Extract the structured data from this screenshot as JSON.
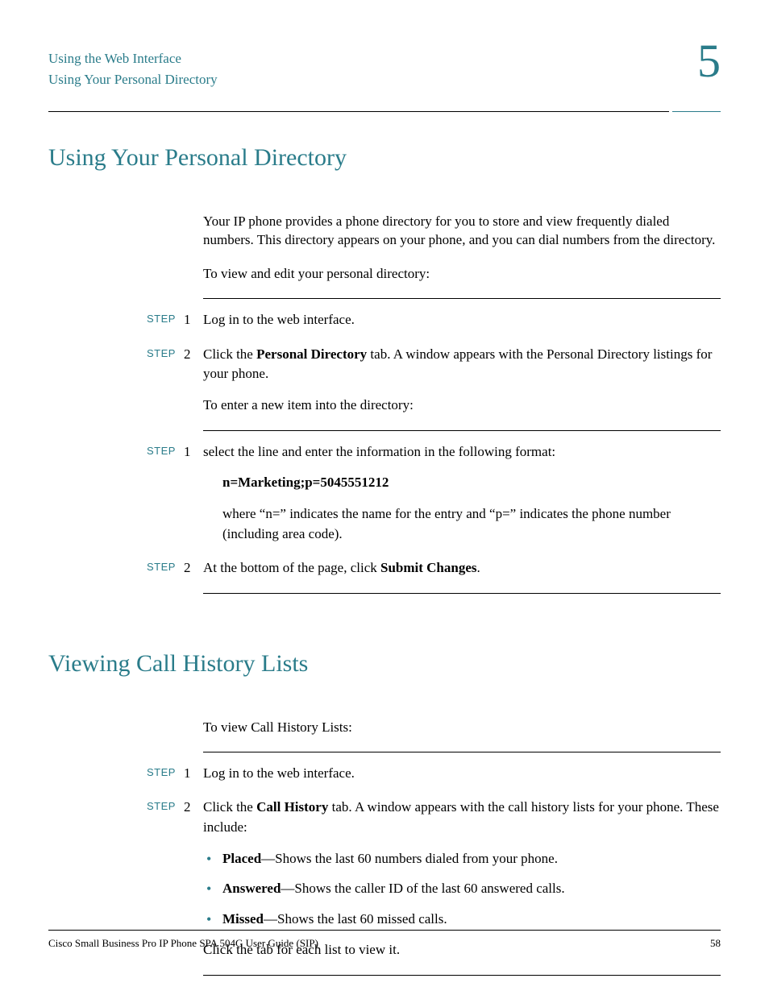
{
  "header": {
    "line1": "Using the Web Interface",
    "line2": "Using Your Personal Directory",
    "chapter_number": "5"
  },
  "section1": {
    "title": "Using Your Personal Directory",
    "intro1": "Your IP phone provides a phone directory for you to store and view frequently dialed numbers. This directory appears on your phone, and you can dial numbers from the directory.",
    "intro2": "To view and edit your personal directory:",
    "steps_a": [
      {
        "label": "STEP",
        "num": "1",
        "text_plain": "Log in to the web interface."
      },
      {
        "label": "STEP",
        "num": "2",
        "prefix": "Click the ",
        "bold": "Personal Directory",
        "suffix": " tab. A window appears with the Personal Directory listings for your phone.",
        "followup": "To enter a new item into the directory:"
      }
    ],
    "steps_b": [
      {
        "label": "STEP",
        "num": "1",
        "lead": "select the line and enter the information in the following format:",
        "code": "n=Marketing;p=5045551212",
        "explain": "where “n=” indicates the name for the entry and “p=” indicates the phone number (including area code)."
      },
      {
        "label": "STEP",
        "num": "2",
        "prefix": "At the bottom of the page, click ",
        "bold": "Submit Changes",
        "suffix": "."
      }
    ]
  },
  "section2": {
    "title": "Viewing Call History Lists",
    "intro": "To view Call History Lists:",
    "steps": [
      {
        "label": "STEP",
        "num": "1",
        "text_plain": "Log in to the web interface."
      },
      {
        "label": "STEP",
        "num": "2",
        "prefix": "Click the ",
        "bold": "Call History",
        "suffix": " tab. A window appears with the call history lists for your phone. These include:",
        "bullets": [
          {
            "bold": "Placed",
            "rest": "—Shows the last 60 numbers dialed from your phone."
          },
          {
            "bold": "Answered",
            "rest": "—Shows the caller ID of the last 60 answered calls."
          },
          {
            "bold": "Missed",
            "rest": "—Shows the last 60 missed calls."
          }
        ],
        "closing": "Click the tab for each list to view it."
      }
    ]
  },
  "footer": {
    "title": "Cisco Small Business Pro IP Phone SPA 504G User Guide (SIP)",
    "page": "58"
  }
}
